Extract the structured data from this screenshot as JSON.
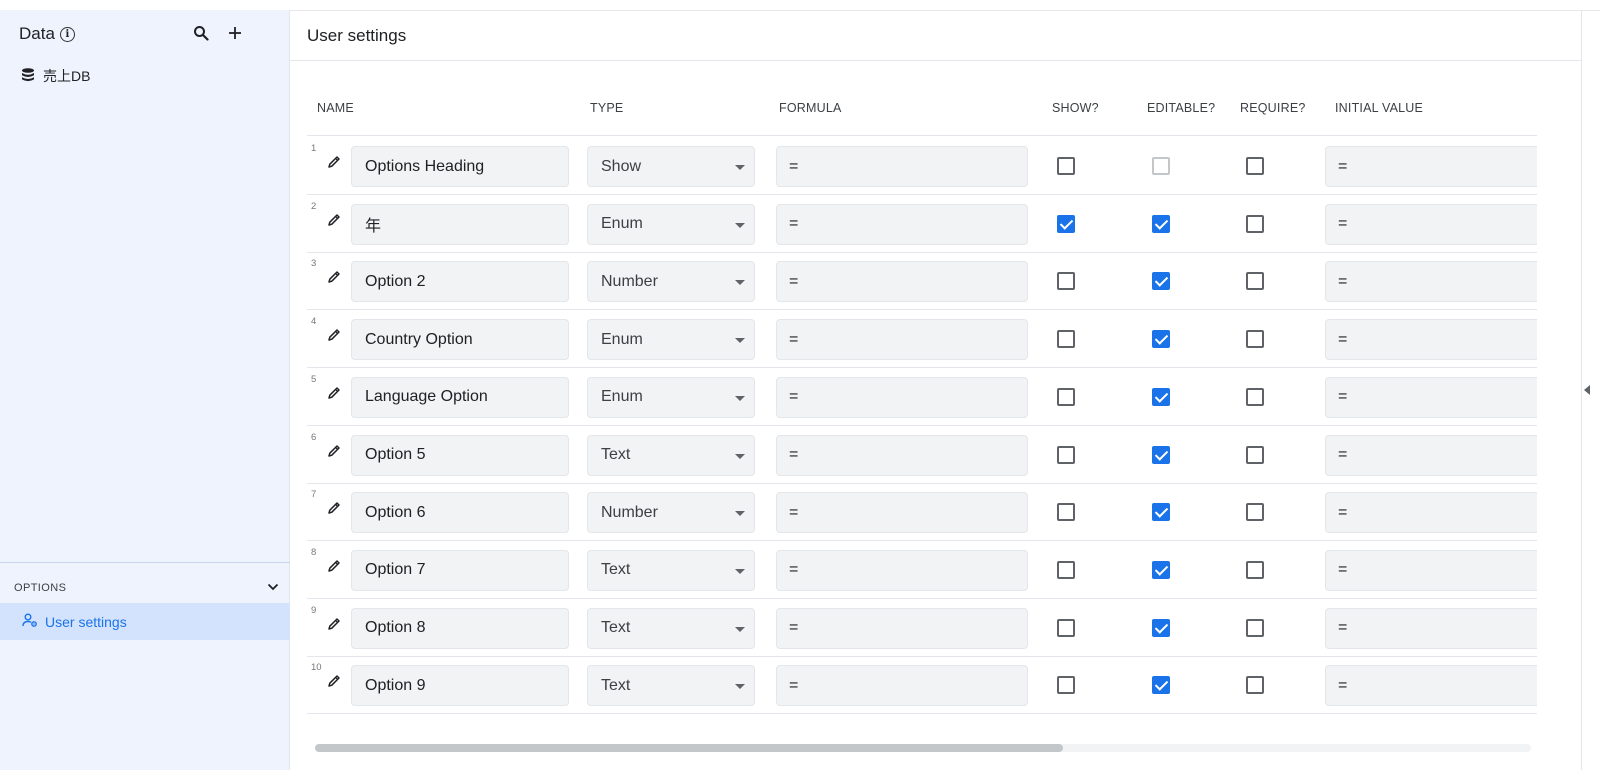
{
  "sidebar": {
    "title": "Data",
    "db_item": "売上DB",
    "options_label": "OPTIONS",
    "selected_item": "User settings"
  },
  "main": {
    "title": "User settings",
    "columns": {
      "name": "NAME",
      "type": "TYPE",
      "formula": "FORMULA",
      "show": "SHOW?",
      "editable": "EDITABLE?",
      "require": "REQUIRE?",
      "initial": "INITIAL VALUE"
    },
    "rows": [
      {
        "num": "1",
        "name": "Options Heading",
        "type": "Show",
        "formula": "=",
        "show": false,
        "editable": false,
        "editable_disabled": true,
        "require": false,
        "initial": "="
      },
      {
        "num": "2",
        "name": "年",
        "type": "Enum",
        "formula": "=",
        "show": true,
        "editable": true,
        "require": false,
        "initial": "="
      },
      {
        "num": "3",
        "name": "Option 2",
        "type": "Number",
        "formula": "=",
        "show": false,
        "editable": true,
        "require": false,
        "initial": "="
      },
      {
        "num": "4",
        "name": "Country Option",
        "type": "Enum",
        "formula": "=",
        "show": false,
        "editable": true,
        "require": false,
        "initial": "="
      },
      {
        "num": "5",
        "name": "Language Option",
        "type": "Enum",
        "formula": "=",
        "show": false,
        "editable": true,
        "require": false,
        "initial": "="
      },
      {
        "num": "6",
        "name": "Option 5",
        "type": "Text",
        "formula": "=",
        "show": false,
        "editable": true,
        "require": false,
        "initial": "="
      },
      {
        "num": "7",
        "name": "Option 6",
        "type": "Number",
        "formula": "=",
        "show": false,
        "editable": true,
        "require": false,
        "initial": "="
      },
      {
        "num": "8",
        "name": "Option 7",
        "type": "Text",
        "formula": "=",
        "show": false,
        "editable": true,
        "require": false,
        "initial": "="
      },
      {
        "num": "9",
        "name": "Option 8",
        "type": "Text",
        "formula": "=",
        "show": false,
        "editable": true,
        "require": false,
        "initial": "="
      },
      {
        "num": "10",
        "name": "Option 9",
        "type": "Text",
        "formula": "=",
        "show": false,
        "editable": true,
        "require": false,
        "initial": "="
      }
    ]
  },
  "icons": {
    "info": "info-icon",
    "search": "search-icon",
    "add": "plus-icon",
    "database": "database-icon",
    "chevron": "chevron-down-icon",
    "user_settings": "user-gear-icon",
    "edit": "pencil-icon"
  },
  "colors": {
    "accent": "#1a73e8",
    "sidebar_bg": "#eef3fd",
    "selected_bg": "#d3e3fd",
    "field_bg": "#f1f3f4"
  }
}
